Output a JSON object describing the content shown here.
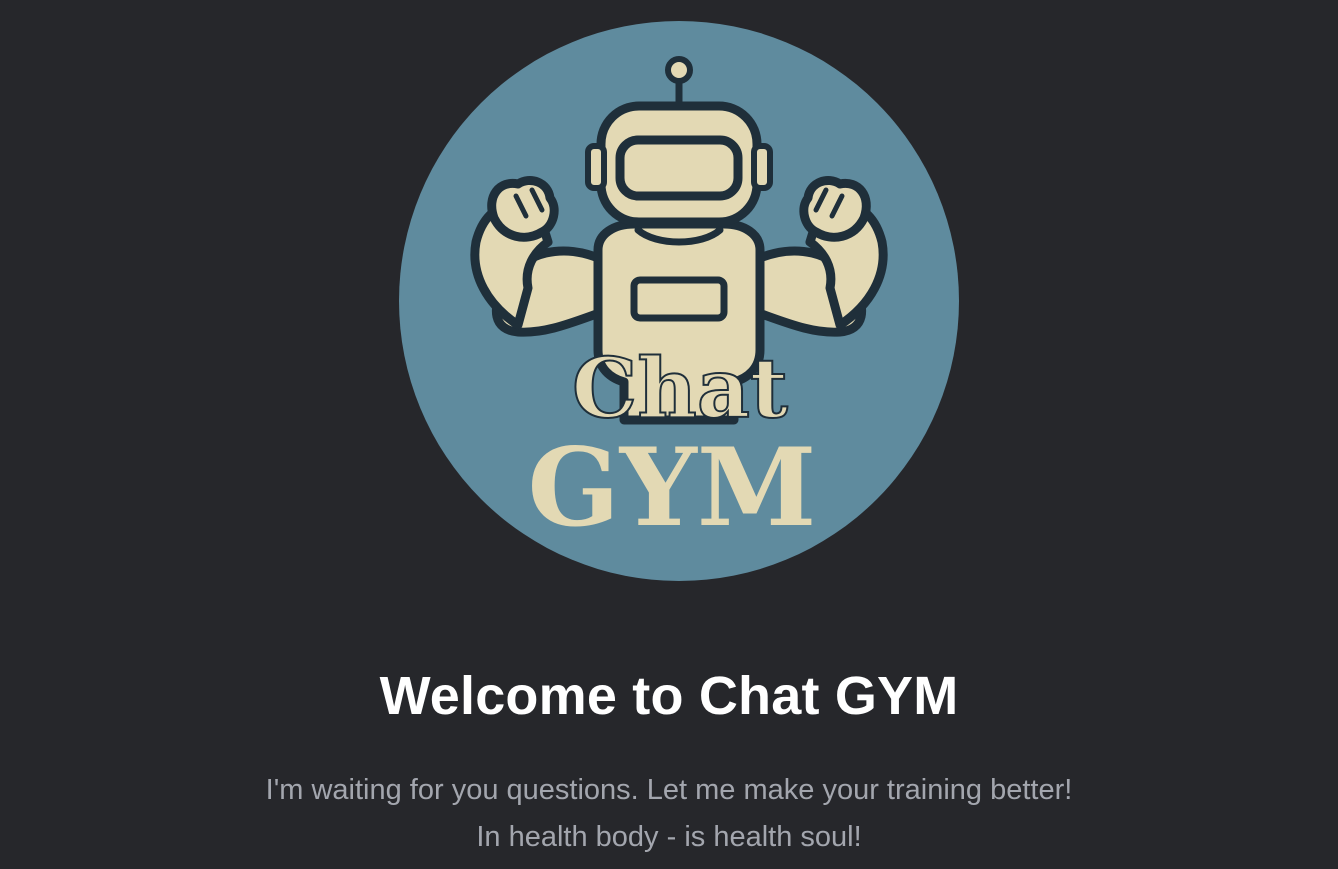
{
  "colors": {
    "background": "#26272b",
    "logo_circle": "#5f8b9e",
    "robot_body": "#e3d9b4",
    "robot_outline": "#1f2f3a",
    "title_text": "#ffffff",
    "subtitle_text": "#a3a6ae"
  },
  "logo": {
    "icon": "muscle-robot-icon",
    "word_top": "Chat",
    "word_bottom": "GYM"
  },
  "welcome": {
    "title": "Welcome to Chat GYM",
    "subtitle_line1": "I'm waiting for you questions. Let me make your training better!",
    "subtitle_line2": "In health body - is health soul!"
  }
}
